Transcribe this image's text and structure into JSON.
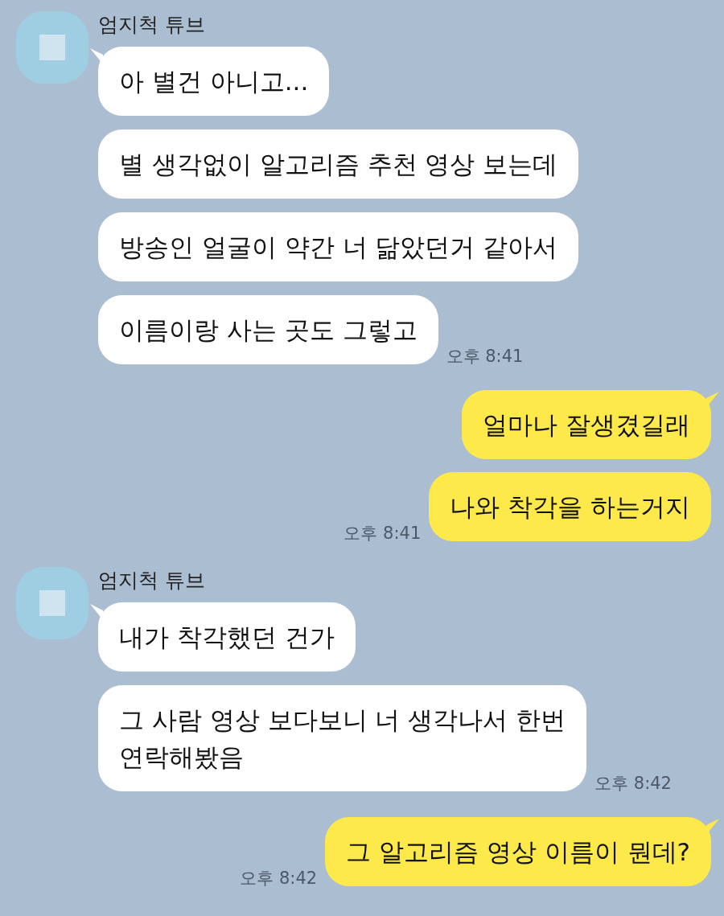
{
  "messages_groups": [
    {
      "kind": "received",
      "sender": "엄지척 튜브",
      "messages": [
        "아 별건 아니고...",
        "별 생각없이 알고리즘 추천 영상 보는데",
        "방송인 얼굴이 약간 너 닮았던거 같아서",
        "이름이랑 사는 곳도 그렇고"
      ],
      "time": "오후 8:41"
    },
    {
      "kind": "sent",
      "messages": [
        "얼마나 잘생겼길래",
        "나와 착각을 하는거지"
      ],
      "time": "오후 8:41"
    },
    {
      "kind": "received",
      "sender": "엄지척 튜브",
      "messages": [
        "내가 착각했던 건가",
        "그 사람 영상 보다보니 너 생각나서 한번\n연락해봤음"
      ],
      "time": "오후 8:42"
    },
    {
      "kind": "sent",
      "messages": [
        "그 알고리즘 영상 이름이 뭔데?"
      ],
      "time": "오후 8:42"
    }
  ]
}
